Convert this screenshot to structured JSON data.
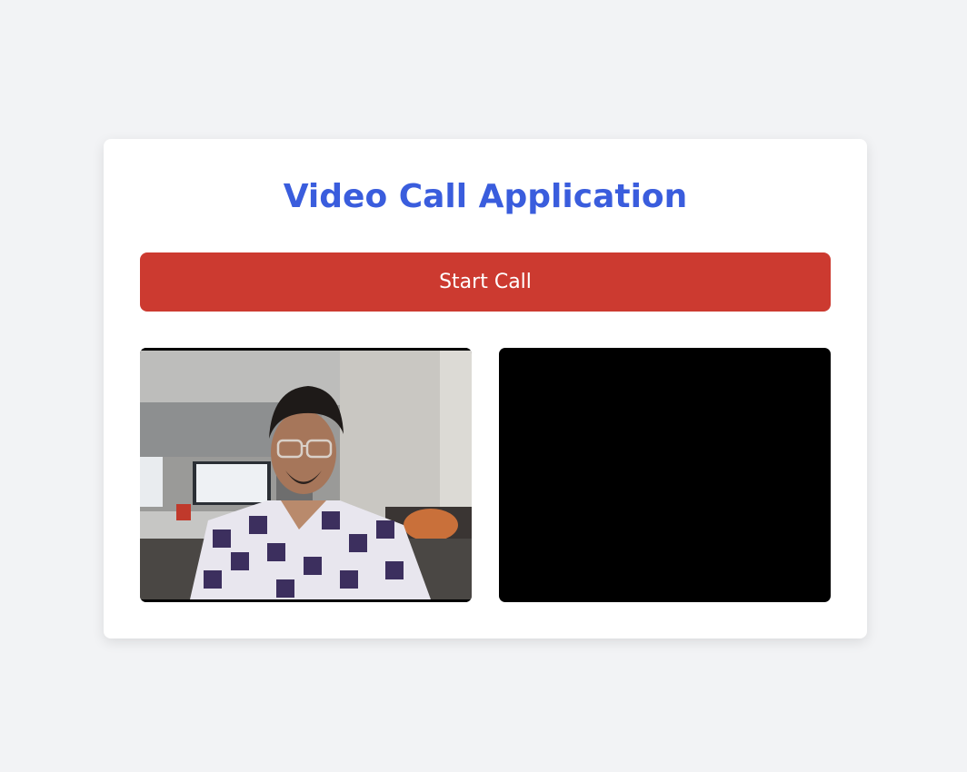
{
  "app": {
    "title": "Video Call Application"
  },
  "controls": {
    "start_call_label": "Start Call"
  },
  "videos": {
    "local": {
      "state": "live",
      "content": "webcam feed"
    },
    "remote": {
      "state": "empty"
    }
  },
  "colors": {
    "background": "#f2f3f5",
    "card": "#ffffff",
    "title": "#3a5ddd",
    "button": "#cc3a30",
    "button_text": "#ffffff",
    "video_bg": "#000000"
  }
}
